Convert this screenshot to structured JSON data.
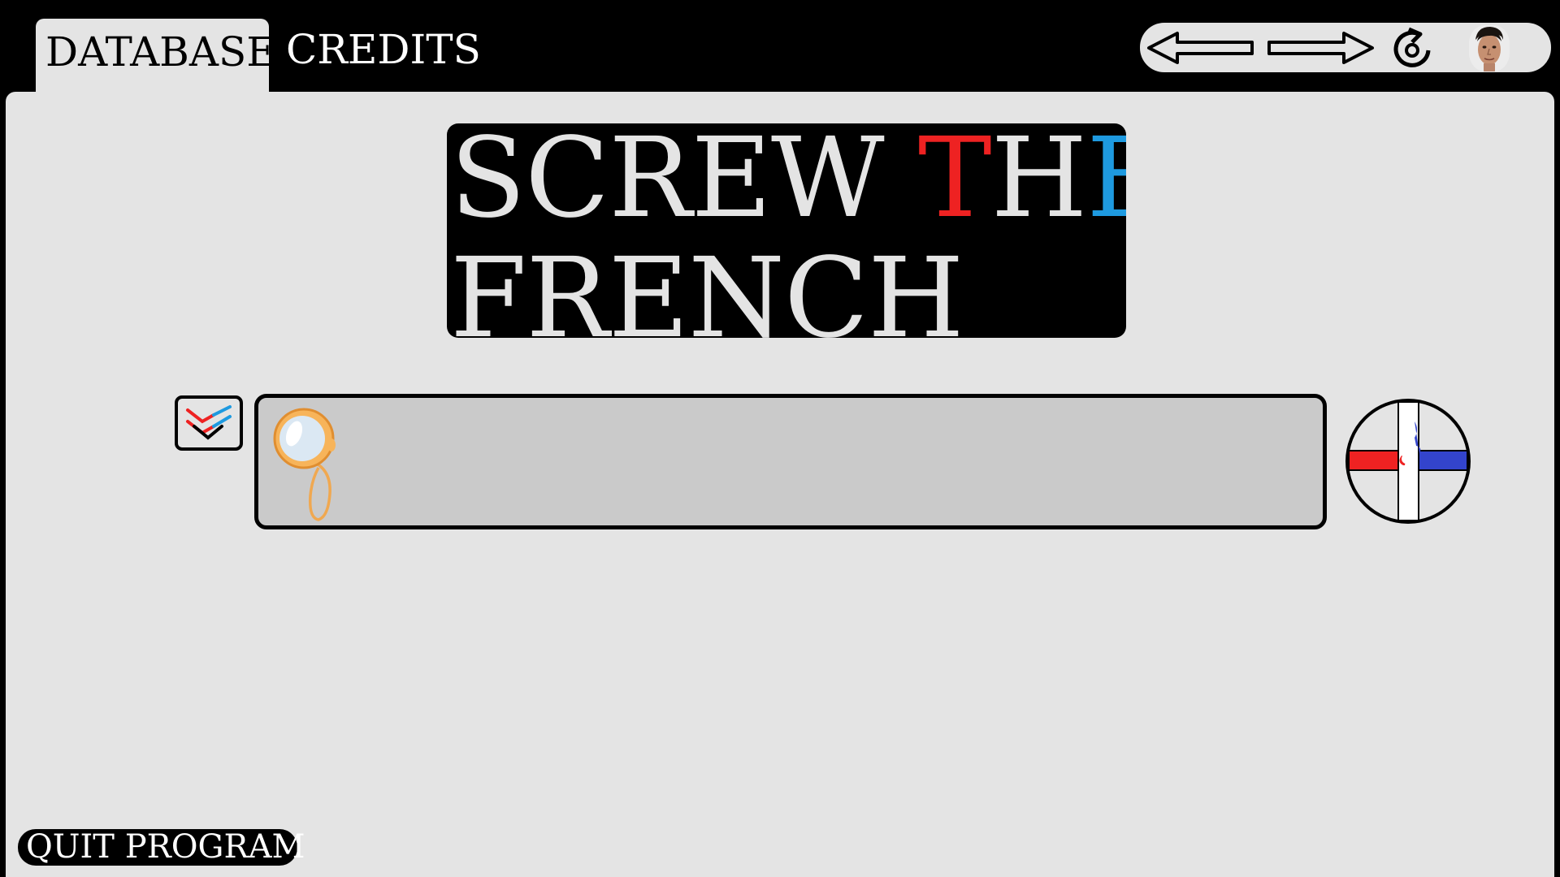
{
  "tabs": [
    {
      "label": "DATABASE",
      "active": true
    },
    {
      "label": "CREDITS",
      "active": false
    }
  ],
  "nav": {
    "back_icon": "arrow-left-icon",
    "forward_icon": "arrow-right-icon",
    "refresh_icon": "refresh-icon",
    "avatar_icon": "user-avatar"
  },
  "title": {
    "line1": {
      "part1": "SCREW ",
      "red": "T",
      "white": "H",
      "blue": "E"
    },
    "line2": "FRENCH"
  },
  "search": {
    "value": "",
    "placeholder": "",
    "icon": "monocle-icon"
  },
  "filter_icon": "double-chevron-down-icon",
  "add_icon": "plus-circle-icon",
  "quit_label": "QUIT PROGRAM",
  "colors": {
    "background": "#000000",
    "panel": "#e4e4e4",
    "search_field": "#cacaca",
    "accent_red": "#ee2222",
    "accent_blue": "#1e9ae0",
    "plus_blue": "#3344cc"
  }
}
